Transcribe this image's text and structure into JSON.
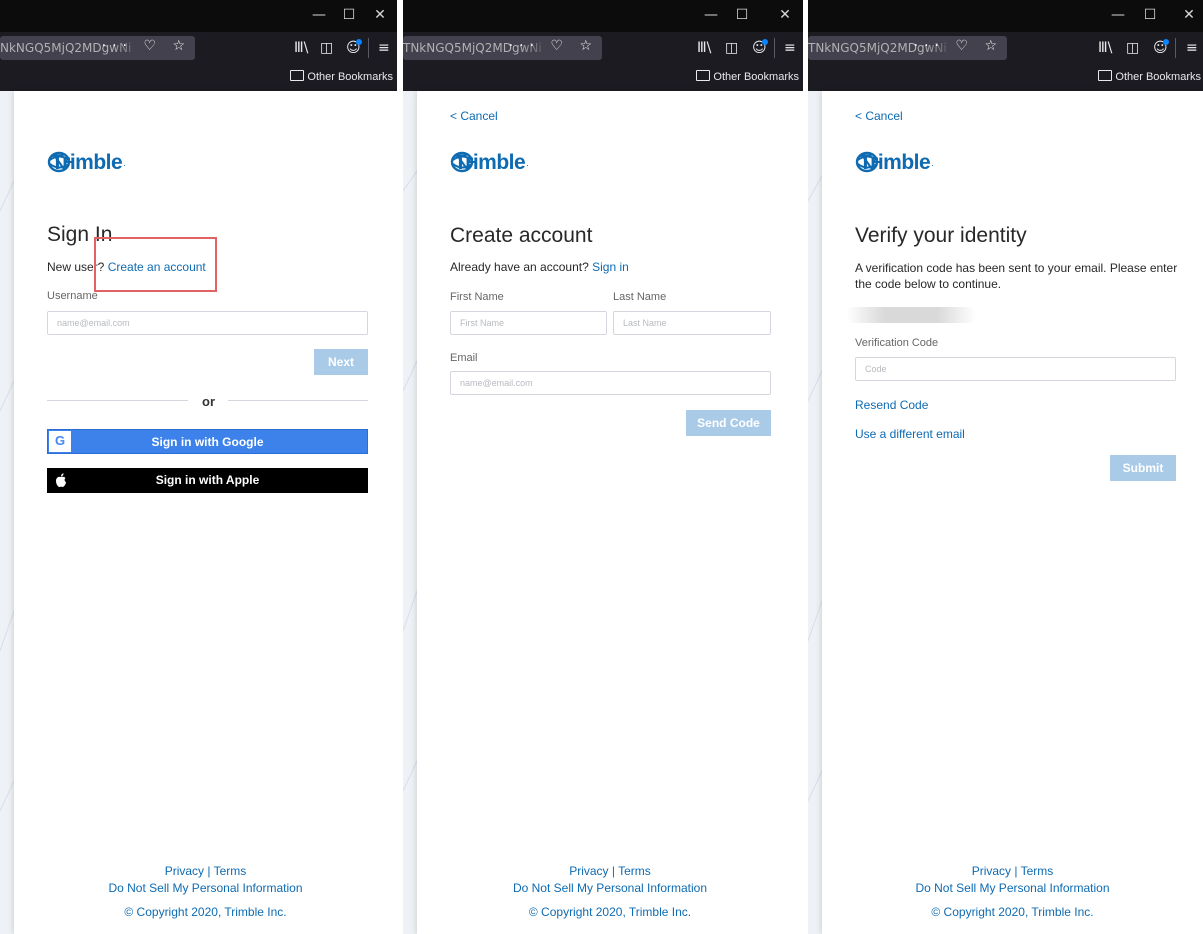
{
  "browser": {
    "panels": [
      {
        "url": "NkNGQ5MjQ2MDgwNi"
      },
      {
        "url": "TNkNGQ5MjQ2MDgwNi"
      },
      {
        "url": "TNkNGQ5MjQ2MDgwNi"
      }
    ],
    "window": {
      "minimize": "—",
      "maximize": "☐",
      "close": "✕"
    },
    "url_icons": "··· ♡ ☆",
    "library_icon": "Ⅲ\\",
    "sidebar_icon": "◫",
    "account_icon": "☺",
    "menu_icon": "≡",
    "bookmarks_label": "Other Bookmarks",
    "accent_color": "#0a84ff"
  },
  "brand": {
    "logo_text": "Trimble",
    "logo_dot": ".",
    "color": "#0e6bb2"
  },
  "sign_in": {
    "title": "Sign In",
    "new_user_text": "New user?",
    "create_link": "Create an account",
    "username_label": "Username",
    "username_placeholder": "name@email.com",
    "next_button": "Next",
    "or_text": "or",
    "google_button": "Sign in with Google",
    "google_letter": "G",
    "apple_button": "Sign in with Apple"
  },
  "create_account": {
    "cancel": "< Cancel",
    "title": "Create account",
    "have_account_text": "Already have an account?",
    "signin_link": "Sign in",
    "first_name_label": "First Name",
    "first_name_placeholder": "First Name",
    "last_name_label": "Last Name",
    "last_name_placeholder": "Last Name",
    "email_label": "Email",
    "email_placeholder": "name@email.com",
    "send_code_button": "Send Code"
  },
  "verify": {
    "cancel": "< Cancel",
    "title": "Verify your identity",
    "message_line1": "A verification code has been sent to your email. Please enter",
    "message_line2": "the code below to continue.",
    "code_label": "Verification Code",
    "code_placeholder": "Code",
    "resend_link": "Resend Code",
    "different_email_link": "Use a different email",
    "submit_button": "Submit"
  },
  "footer": {
    "privacy": "Privacy",
    "separator": "|",
    "terms": "Terms",
    "do_not_sell": "Do Not Sell My Personal Information",
    "copyright": "© Copyright 2020, Trimble Inc."
  }
}
